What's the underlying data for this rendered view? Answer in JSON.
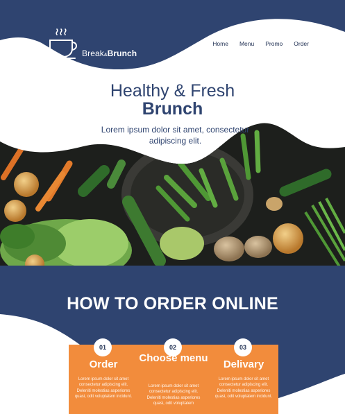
{
  "brand": {
    "name_regular": "Break",
    "name_amp": "&",
    "name_bold": "Brunch"
  },
  "nav": {
    "items": [
      "Home",
      "Menu",
      "Promo",
      "Order"
    ]
  },
  "hero": {
    "title_line1": "Healthy & Fresh",
    "title_line2": "Brunch",
    "subtitle": "Lorem ipsum dolor sit amet, consectetur adipiscing elit."
  },
  "order_section": {
    "title_light": "HOW TO ",
    "title_bold": "ORDER ONLINE",
    "steps": [
      {
        "number": "01",
        "title": "Order",
        "text": "Lorem ipsum dolor sit amet consectetur adipiscing elit. Deleniti molestias asperiores quasi, odit voluptatem incidunt."
      },
      {
        "number": "02",
        "title": "Choose menu",
        "text": "Lorem ipsum dolor sit amet consectetur adipiscing elit. Deleniti molestias asperiores quasi, odit voluptatem"
      },
      {
        "number": "03",
        "title": "Delivary",
        "text": "Lorem ipsum dolor sit amet consectetur adipiscing elit. Deleniti molestias asperiores quasi, odit voluptatem incidunt."
      }
    ]
  },
  "colors": {
    "navy": "#2f4470",
    "orange": "#f28c3c",
    "white": "#ffffff"
  },
  "icons": {
    "logo": "coffee-cup-icon",
    "hero_image": "vegetables-photo"
  }
}
